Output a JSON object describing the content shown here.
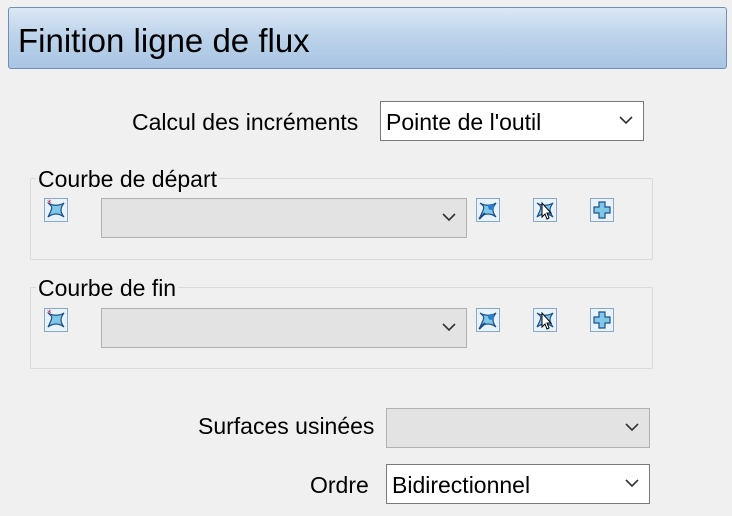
{
  "header": {
    "title": "Finition ligne de flux"
  },
  "increments": {
    "label": "Calcul des incréments",
    "value": "Pointe de l'outil"
  },
  "start_curve": {
    "label": "Courbe de départ",
    "value": "",
    "icons": [
      "draw-curve-icon",
      "pick-curve-icon",
      "select-cursor-icon",
      "add-curve-icon"
    ]
  },
  "end_curve": {
    "label": "Courbe de fin",
    "value": "",
    "icons": [
      "draw-curve-icon",
      "pick-curve-icon",
      "select-cursor-icon",
      "add-curve-icon"
    ]
  },
  "surfaces": {
    "label": "Surfaces usinées",
    "value": ""
  },
  "order": {
    "label": "Ordre",
    "value": "Bidirectionnel"
  },
  "colors": {
    "header_top": "#dce8f5",
    "header_bottom": "#a9c5e3",
    "icon_fill": "#7fc8e8",
    "icon_stroke": "#1f4f8a"
  }
}
